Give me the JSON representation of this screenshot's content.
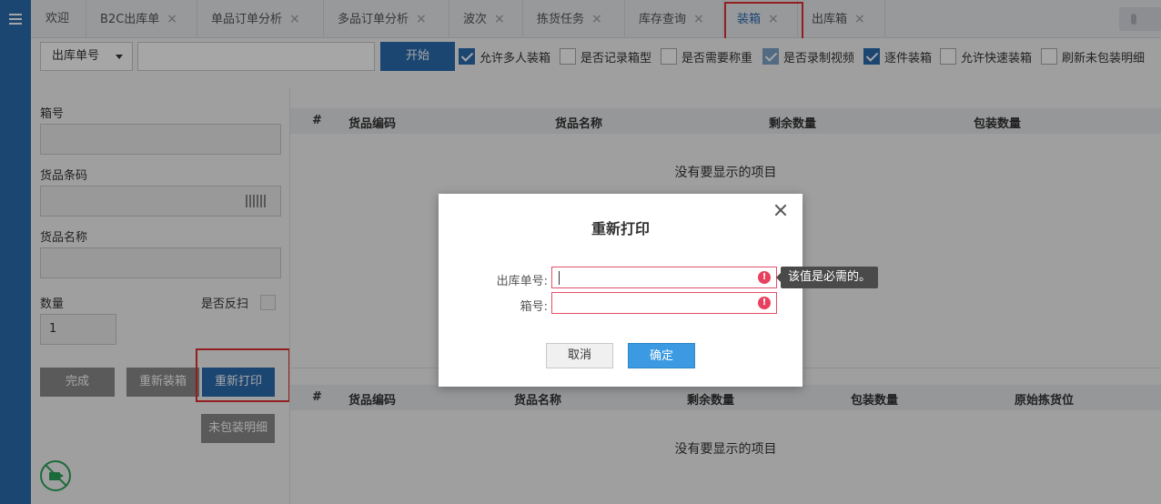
{
  "tabs": [
    {
      "label": "欢迎",
      "closable": false
    },
    {
      "label": "B2C出库单",
      "closable": true
    },
    {
      "label": "单品订单分析",
      "closable": true
    },
    {
      "label": "多品订单分析",
      "closable": true
    },
    {
      "label": "波次",
      "closable": true
    },
    {
      "label": "拣货任务",
      "closable": true
    },
    {
      "label": "库存查询",
      "closable": true
    },
    {
      "label": "装箱",
      "closable": true,
      "active": true
    },
    {
      "label": "出库箱",
      "closable": true
    }
  ],
  "tab_close_glyph": "×",
  "toolbar": {
    "search_type": "出库单号",
    "start_label": "开始",
    "options": [
      {
        "label": "允许多人装箱",
        "checked": true
      },
      {
        "label": "是否记录箱型",
        "checked": false
      },
      {
        "label": "是否需要称重",
        "checked": false
      },
      {
        "label": "是否录制视频",
        "checked": true,
        "disabled": true
      },
      {
        "label": "逐件装箱",
        "checked": true
      },
      {
        "label": "允许快速装箱",
        "checked": false
      },
      {
        "label": "刷新未包装明细",
        "checked": false
      }
    ]
  },
  "form": {
    "box_no_label": "箱号",
    "barcode_label": "货品条码",
    "name_label": "货品名称",
    "qty_label": "数量",
    "qty_value": "1",
    "rescan_label": "是否反扫",
    "done_label": "完成",
    "repack_label": "重新装箱",
    "reprint_label": "重新打印",
    "unpacked_label": "未包装明细"
  },
  "grid_top": {
    "columns": [
      "#",
      "货品编码",
      "货品名称",
      "剩余数量",
      "包装数量"
    ],
    "empty_text": "没有要显示的项目"
  },
  "grid_bottom": {
    "columns": [
      "#",
      "货品编码",
      "货品名称",
      "剩余数量",
      "包装数量",
      "原始拣货位"
    ],
    "empty_text": "没有要显示的项目"
  },
  "modal": {
    "title": "重新打印",
    "order_label": "出库单号:",
    "box_label": "箱号:",
    "error_glyph": "!",
    "required_tip": "该值是必需的。",
    "cancel_label": "取消",
    "ok_label": "确定"
  },
  "colors": {
    "primary": "#2b6cb0",
    "highlight_box": "#e03030",
    "error": "#e8415f",
    "confirm": "#3b9ae1"
  }
}
